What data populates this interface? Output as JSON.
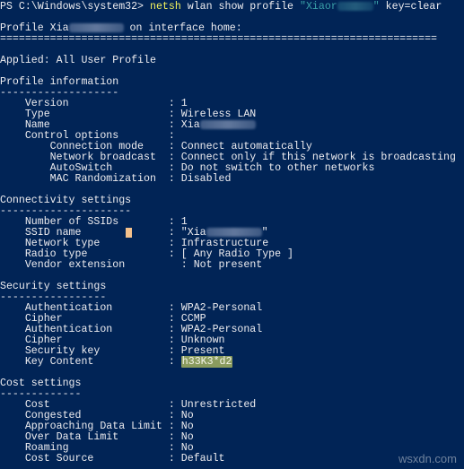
{
  "window": {
    "theme": "powershell",
    "background": "#012456",
    "text_color": "#eeedf0"
  },
  "command": {
    "prompt": "PS C:\\Windows\\system32> ",
    "cmd": "netsh",
    "args": " wlan show profile ",
    "profile_arg_prefix": "\"Xiaor",
    "profile_arg_suffix": "\"",
    "profile_arg_redacted": true,
    "tail": " key=clear",
    "cmd_color": "#f2f25c",
    "string_color": "#3aa0a8"
  },
  "header": {
    "prefix": "Profile Xia",
    "suffix": " on interface home:",
    "separator": "======================================================================",
    "applied": "Applied: All User Profile"
  },
  "sections": {
    "profile": {
      "title": "Profile information",
      "underline": "-------------------",
      "rows": [
        {
          "label": "Version",
          "sep": ": ",
          "value": "1"
        },
        {
          "label": "Type",
          "sep": ": ",
          "value": "Wireless LAN"
        },
        {
          "label": "Name",
          "sep": ": ",
          "value": "Xia",
          "redacted": true
        },
        {
          "label": "Control options",
          "sep": ":",
          "value": ""
        }
      ],
      "sub_rows": [
        {
          "label": "Connection mode",
          "sep": ": ",
          "value": "Connect automatically"
        },
        {
          "label": "Network broadcast",
          "sep": ": ",
          "value": "Connect only if this network is broadcasting"
        },
        {
          "label": "AutoSwitch",
          "sep": ": ",
          "value": "Do not switch to other networks"
        },
        {
          "label": "MAC Randomization",
          "sep": ": ",
          "value": "Disabled"
        }
      ]
    },
    "connectivity": {
      "title": "Connectivity settings",
      "underline": "---------------------",
      "rows": [
        {
          "label": "Number of SSIDs",
          "sep": ": ",
          "value": "1"
        },
        {
          "label": "SSID name",
          "sep": ": ",
          "value": "\"Xia",
          "value_suffix": "\"",
          "redacted": true
        },
        {
          "label": "Network type",
          "sep": ": ",
          "value": "Infrastructure"
        },
        {
          "label": "Radio type",
          "sep": ": ",
          "value": "[ Any Radio Type ]"
        },
        {
          "label": "Vendor extension",
          "sep": "  : ",
          "value": "Not present"
        }
      ]
    },
    "security": {
      "title": "Security settings",
      "underline": "-----------------",
      "rows": [
        {
          "label": "Authentication",
          "sep": ": ",
          "value": "WPA2-Personal"
        },
        {
          "label": "Cipher",
          "sep": ": ",
          "value": "CCMP"
        },
        {
          "label": "Authentication",
          "sep": ": ",
          "value": "WPA2-Personal"
        },
        {
          "label": "Cipher",
          "sep": ": ",
          "value": "Unknown"
        },
        {
          "label": "Security key",
          "sep": ": ",
          "value": "Present"
        },
        {
          "label": "Key Content",
          "sep": ": ",
          "value": "h33K3*d2",
          "highlighted": true
        }
      ]
    },
    "cost": {
      "title": "Cost settings",
      "underline": "-------------",
      "rows": [
        {
          "label": "Cost",
          "sep": ": ",
          "value": "Unrestricted"
        },
        {
          "label": "Congested",
          "sep": ": ",
          "value": "No"
        },
        {
          "label": "Approaching Data Limit",
          "sep": ": ",
          "value": "No"
        },
        {
          "label": "Over Data Limit",
          "sep": ": ",
          "value": "No"
        },
        {
          "label": "Roaming",
          "sep": ": ",
          "value": "No"
        },
        {
          "label": "Cost Source",
          "sep": ": ",
          "value": "Default"
        }
      ]
    }
  },
  "highlight_color": "#8a9b5e",
  "cursor_color": "#f4c18c",
  "watermark": "wsxdn.com"
}
